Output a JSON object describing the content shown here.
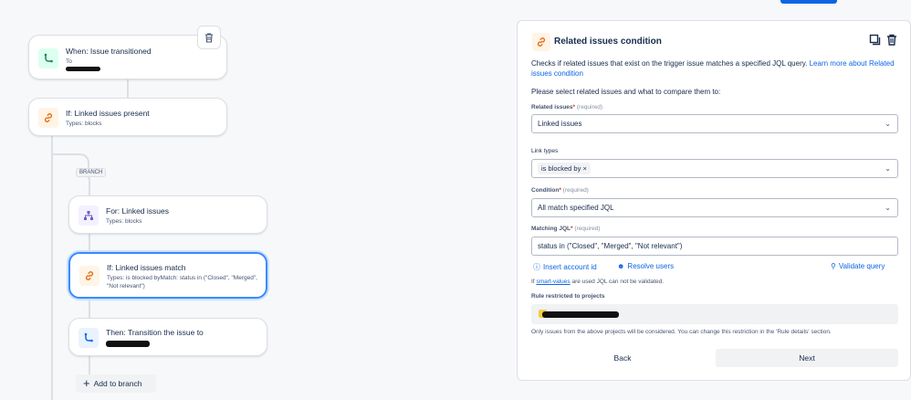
{
  "flow": {
    "trigger": {
      "title": "When: Issue transitioned",
      "subtitle": "To"
    },
    "condition": {
      "title": "If: Linked issues present",
      "subtitle": "Types: blocks"
    },
    "branch_label": "BRANCH",
    "for_node": {
      "title": "For: Linked issues",
      "subtitle": "Types: blocks"
    },
    "match_node": {
      "title": "If: Linked issues match",
      "subtitle": "Types: is blocked byMatch: status in (\"Closed\", \"Merged\", \"Not relevant\")"
    },
    "then_node": {
      "title": "Then: Transition the issue to"
    },
    "add_branch": "Add to branch"
  },
  "panel": {
    "title": "Related issues condition",
    "description": "Checks if related issues that exist on the trigger issue matches a specified JQL query.",
    "learn_more": "Learn more about Related issues condition",
    "instruction": "Please select related issues and what to compare them to:",
    "related_label": "Related issues",
    "related_value": "Linked issues",
    "link_types_label": "Link types",
    "link_type_chip": "is blocked by",
    "condition_label": "Condition",
    "condition_value": "All match specified JQL",
    "jql_label": "Matching JQL",
    "jql_value": "status in (\"Closed\", \"Merged\", \"Not relevant\")",
    "required": "(required)",
    "insert_account": "Insert account id",
    "resolve_users": "Resolve users",
    "validate_query": "Validate query",
    "smart_values_note_link": "smart-values",
    "smart_values_note_pre": "If",
    "smart_values_note": "are used JQL can not be validated.",
    "projects_label": "Rule restricted to projects",
    "projects_note": "Only issues from the above projects will be considered. You can change this restriction in the 'Rule details' section.",
    "back": "Back",
    "next": "Next"
  },
  "colors": {
    "accent": "#0c66e4",
    "trigger_icon_bg": "#dcfff1",
    "condition_icon_bg": "#fff4e5",
    "branch_icon_bg": "#f3f0ff",
    "action_icon_bg": "#e9f2ff"
  }
}
